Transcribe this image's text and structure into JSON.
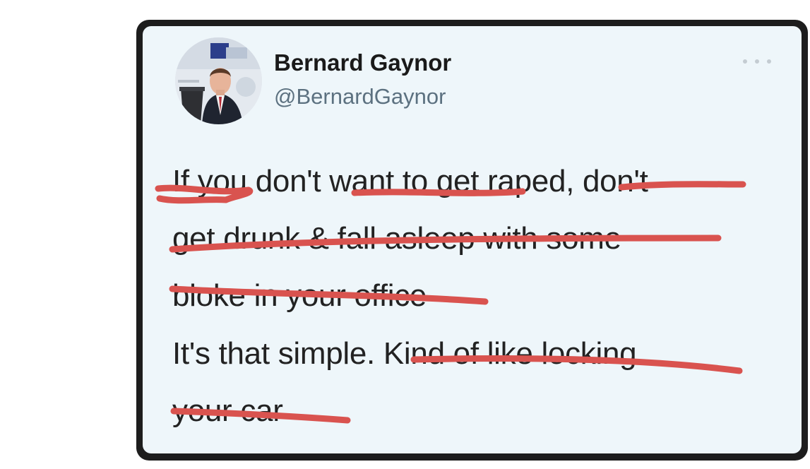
{
  "tweet": {
    "display_name": "Bernard Gaynor",
    "handle": "@BernardGaynor",
    "avatar_icon": "profile-photo",
    "more_icon": "ellipsis-icon",
    "lines": [
      "If you don't want to get raped, don't",
      "get drunk & fall asleep with some",
      "bloke in your office",
      "It's that simple. Kind of like locking",
      "your car"
    ]
  },
  "annotation": {
    "strike_color": "#d9534f"
  }
}
